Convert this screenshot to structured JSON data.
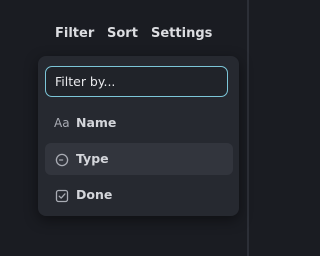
{
  "menubar": {
    "items": [
      {
        "label": "Filter"
      },
      {
        "label": "Sort"
      },
      {
        "label": "Settings"
      }
    ]
  },
  "filter_panel": {
    "search": {
      "value": "",
      "placeholder": "Filter by..."
    },
    "options": [
      {
        "icon_text": "Aa",
        "icon": "text-type-icon",
        "label": "Name",
        "highlighted": false
      },
      {
        "icon": "clock-icon",
        "label": "Type",
        "highlighted": true
      },
      {
        "icon": "checkbox-checked-icon",
        "label": "Done",
        "highlighted": false
      }
    ]
  },
  "colors": {
    "background": "#1a1c22",
    "panel": "#262930",
    "focus_border": "#7cc6d8",
    "highlight": "#32353d"
  }
}
